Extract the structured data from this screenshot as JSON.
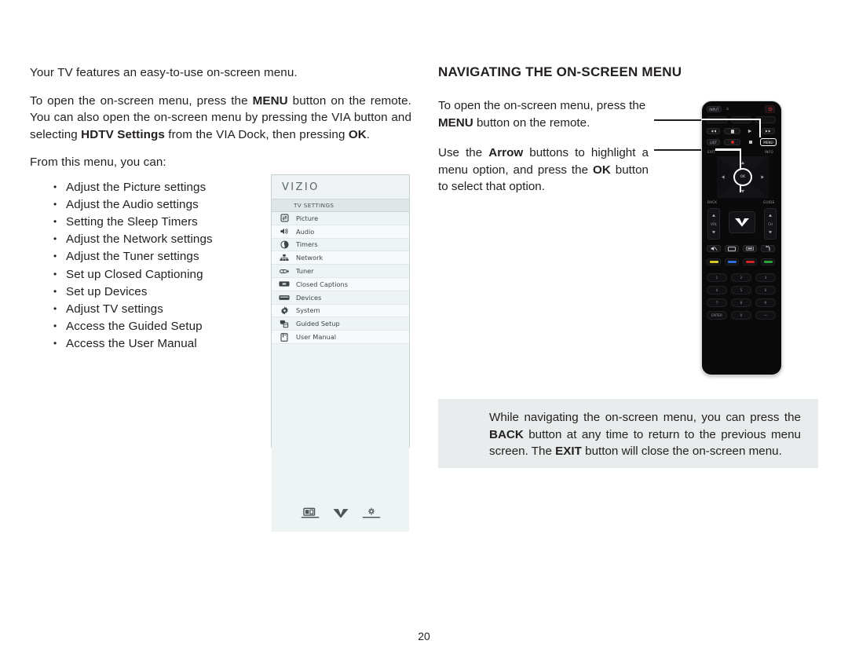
{
  "document": {
    "page_number": "20"
  },
  "left": {
    "intro": "Your TV features an easy-to-use on-screen menu.",
    "p_open_menu_pre": "To open the on-screen menu, press the ",
    "p_open_menu_b1": "MENU",
    "p_open_menu_mid": " button on the remote. You can also open the on-screen menu by pressing the VIA button and selecting ",
    "p_open_menu_b2": "HDTV Settings",
    "p_open_menu_mid2": " from the VIA Dock, then pressing ",
    "p_open_menu_b3": "OK",
    "p_open_menu_end": ".",
    "from_menu": "From this menu, you can:",
    "bullets": [
      "Adjust the Picture settings",
      "Adjust the Audio settings",
      "Setting the Sleep Timers",
      "Adjust the Network settings",
      "Adjust the Tuner settings",
      "Set up Closed Captioning",
      "Set up Devices",
      "Adjust TV settings",
      "Access the Guided Setup",
      "Access the User Manual"
    ]
  },
  "tv_menu": {
    "brand": "VIZIO",
    "header": "TV SETTINGS",
    "items": [
      {
        "label": "Picture",
        "icon": "picture-icon"
      },
      {
        "label": "Audio",
        "icon": "speaker-icon"
      },
      {
        "label": "Timers",
        "icon": "clock-icon"
      },
      {
        "label": "Network",
        "icon": "network-icon"
      },
      {
        "label": "Tuner",
        "icon": "tuner-icon"
      },
      {
        "label": "Closed Captions",
        "icon": "closed-caption-icon"
      },
      {
        "label": "Devices",
        "icon": "devices-icon"
      },
      {
        "label": "System",
        "icon": "gear-icon"
      },
      {
        "label": "Guided Setup",
        "icon": "guided-setup-icon"
      },
      {
        "label": "User Manual",
        "icon": "user-manual-icon"
      }
    ],
    "footer_icons": [
      "screen-icon",
      "vizio-v-icon",
      "settings-icon"
    ]
  },
  "right": {
    "section_title": "NAVIGATING THE ON-SCREEN MENU",
    "p1_pre": "To open the on-screen menu, press the ",
    "p1_b": "MENU",
    "p1_post": " button on the remote.",
    "p2_pre": "Use the ",
    "p2_b1": "Arrow",
    "p2_mid": " buttons to highlight a menu option, and press the ",
    "p2_b2": "OK",
    "p2_post": " button to select that option."
  },
  "note": {
    "pre": "While navigating the on-screen menu, you can press the ",
    "b1": "BACK",
    "mid": " button at any time to return to the previous menu screen. The ",
    "b2": "EXIT",
    "post": " button will close the on-screen menu."
  },
  "remote": {
    "labels": {
      "input": "INPUT",
      "power": "power-icon",
      "list": "LIST",
      "menu": "MENU",
      "exit": "EXIT",
      "info": "INFO",
      "back": "BACK",
      "guide": "GUIDE",
      "ok": "OK",
      "vol": "VOL",
      "ch": "CH",
      "enter": "ENTER",
      "zero": "0",
      "dash": "—"
    },
    "number_keys": [
      "1",
      "2",
      "3",
      "4",
      "5",
      "6",
      "7",
      "8",
      "9"
    ],
    "color_buttons": [
      "#d8c827",
      "#2e6fd8",
      "#cf2424",
      "#2aa13c"
    ]
  },
  "colors": {
    "ink": "#231f20",
    "note_bg": "#e8eced",
    "panel_bg": "#f3f6f6",
    "panel_border": "#c9d2d2"
  }
}
